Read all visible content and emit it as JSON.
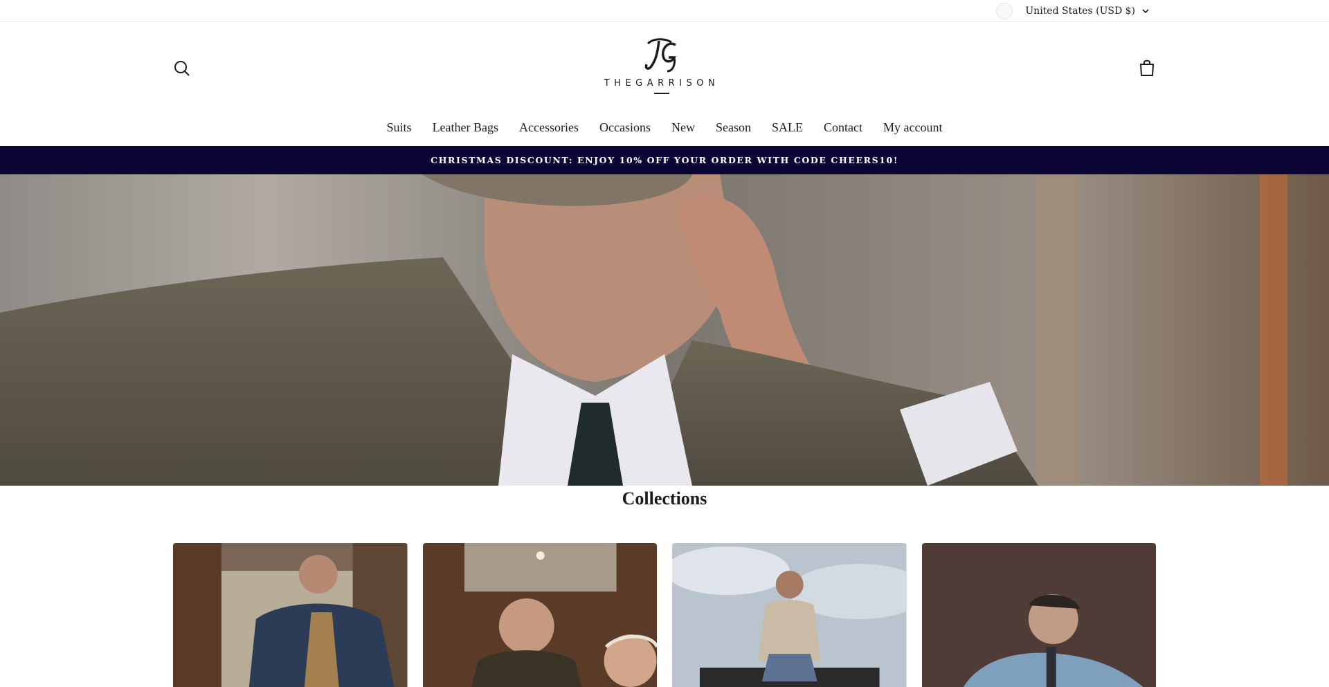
{
  "utility": {
    "currency_label": "United States (USD $)"
  },
  "header": {
    "logo_monogram": "TG",
    "logo_text": "THEGARRISON",
    "search_icon": "search-icon",
    "cart_icon": "cart-icon"
  },
  "nav": {
    "items": [
      {
        "label": "Suits"
      },
      {
        "label": "Leather Bags"
      },
      {
        "label": "Accessories"
      },
      {
        "label": "Occasions"
      },
      {
        "label": "New"
      },
      {
        "label": "Season"
      },
      {
        "label": "SALE"
      },
      {
        "label": "Contact"
      },
      {
        "label": "My account"
      }
    ]
  },
  "announcement": {
    "text": "CHRISTMAS DISCOUNT: ENJOY 10% OFF YOUR ORDER WITH CODE CHEERS10!",
    "background": "#0c0636"
  },
  "collections": {
    "title": "Collections"
  }
}
